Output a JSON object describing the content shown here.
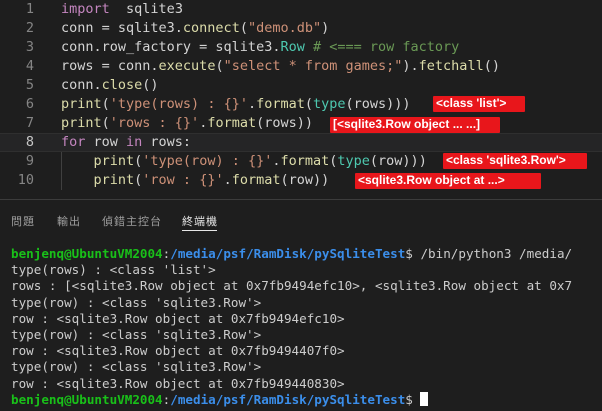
{
  "editor": {
    "lines": [
      {
        "n": "1",
        "segs": [
          [
            "kw",
            "import"
          ],
          [
            "",
            "  "
          ],
          [
            "",
            "sqlite3"
          ]
        ]
      },
      {
        "n": "2",
        "segs": [
          [
            "",
            "conn = sqlite3."
          ],
          [
            "fn",
            "connect"
          ],
          [
            "",
            "("
          ],
          [
            "str",
            "\"demo.db\""
          ],
          [
            "",
            ")"
          ]
        ]
      },
      {
        "n": "3",
        "segs": [
          [
            "",
            "conn.row_factory = sqlite3."
          ],
          [
            "cls",
            "Row"
          ],
          [
            "",
            " "
          ],
          [
            "cm",
            "# <=== row factory"
          ]
        ]
      },
      {
        "n": "4",
        "segs": [
          [
            "",
            "rows = conn."
          ],
          [
            "fn",
            "execute"
          ],
          [
            "",
            "("
          ],
          [
            "str",
            "\"select * from games;\""
          ],
          [
            "",
            ")."
          ],
          [
            "fn",
            "fetchall"
          ],
          [
            "",
            "()"
          ]
        ]
      },
      {
        "n": "5",
        "segs": [
          [
            "",
            "conn."
          ],
          [
            "fn",
            "close"
          ],
          [
            "",
            "()"
          ]
        ]
      },
      {
        "n": "6",
        "segs": [
          [
            "fn",
            "print"
          ],
          [
            "",
            "("
          ],
          [
            "str",
            "'type(rows) : {}'"
          ],
          [
            "",
            "."
          ],
          [
            "fn",
            "format"
          ],
          [
            "",
            "("
          ],
          [
            "cls",
            "type"
          ],
          [
            "",
            "(rows)))"
          ]
        ]
      },
      {
        "n": "7",
        "segs": [
          [
            "fn",
            "print"
          ],
          [
            "",
            "("
          ],
          [
            "str",
            "'rows : {}'"
          ],
          [
            "",
            "."
          ],
          [
            "fn",
            "format"
          ],
          [
            "",
            "(rows))"
          ]
        ]
      },
      {
        "n": "8",
        "segs": [
          [
            "kw",
            "for"
          ],
          [
            "",
            " row "
          ],
          [
            "kw",
            "in"
          ],
          [
            "",
            " rows:"
          ]
        ]
      },
      {
        "n": "9",
        "segs": [
          [
            "",
            "    "
          ],
          [
            "fn",
            "print"
          ],
          [
            "",
            "("
          ],
          [
            "str",
            "'type(row) : {}'"
          ],
          [
            "",
            "."
          ],
          [
            "fn",
            "format"
          ],
          [
            "",
            "("
          ],
          [
            "cls",
            "type"
          ],
          [
            "",
            "(row)))"
          ]
        ]
      },
      {
        "n": "10",
        "segs": [
          [
            "",
            "    "
          ],
          [
            "fn",
            "print"
          ],
          [
            "",
            "("
          ],
          [
            "str",
            "'row : {}'"
          ],
          [
            "",
            "."
          ],
          [
            "fn",
            "format"
          ],
          [
            "",
            "(row))"
          ]
        ]
      }
    ],
    "current_line_index": 7
  },
  "annotations": [
    {
      "id": "ann-1",
      "text": "<class 'list'>",
      "line": 6
    },
    {
      "id": "ann-2",
      "text": "[<sqlite3.Row object ... ...]",
      "line": 7
    },
    {
      "id": "ann-3",
      "text": "<class 'sqlite3.Row'>",
      "line": 9
    },
    {
      "id": "ann-4",
      "text": "<sqlite3.Row object at ...>",
      "line": 10
    }
  ],
  "panel": {
    "tabs": [
      {
        "label": "問題",
        "active": false
      },
      {
        "label": "輸出",
        "active": false
      },
      {
        "label": "偵錯主控台",
        "active": false
      },
      {
        "label": "終端機",
        "active": true
      }
    ]
  },
  "terminal": {
    "prompt_user": "benjenq@UbuntuVM2004",
    "prompt_path": "/media/psf/RamDisk/pySqliteTest",
    "command": "$ /bin/python3 /media/",
    "output": [
      "type(rows) : <class 'list'>",
      "rows : [<sqlite3.Row object at 0x7fb9494efc10>, <sqlite3.Row object at 0x7",
      "type(row) : <class 'sqlite3.Row'>",
      "row : <sqlite3.Row object at 0x7fb9494efc10>",
      "type(row) : <class 'sqlite3.Row'>",
      "row : <sqlite3.Row object at 0x7fb9494407f0>",
      "type(row) : <class 'sqlite3.Row'>",
      "row : <sqlite3.Row object at 0x7fb949440830>"
    ],
    "final_prompt_suffix": "$ "
  },
  "colors": {
    "annotation": "#e8161b",
    "prompt_user": "#19c019",
    "prompt_path": "#3b8eea"
  }
}
